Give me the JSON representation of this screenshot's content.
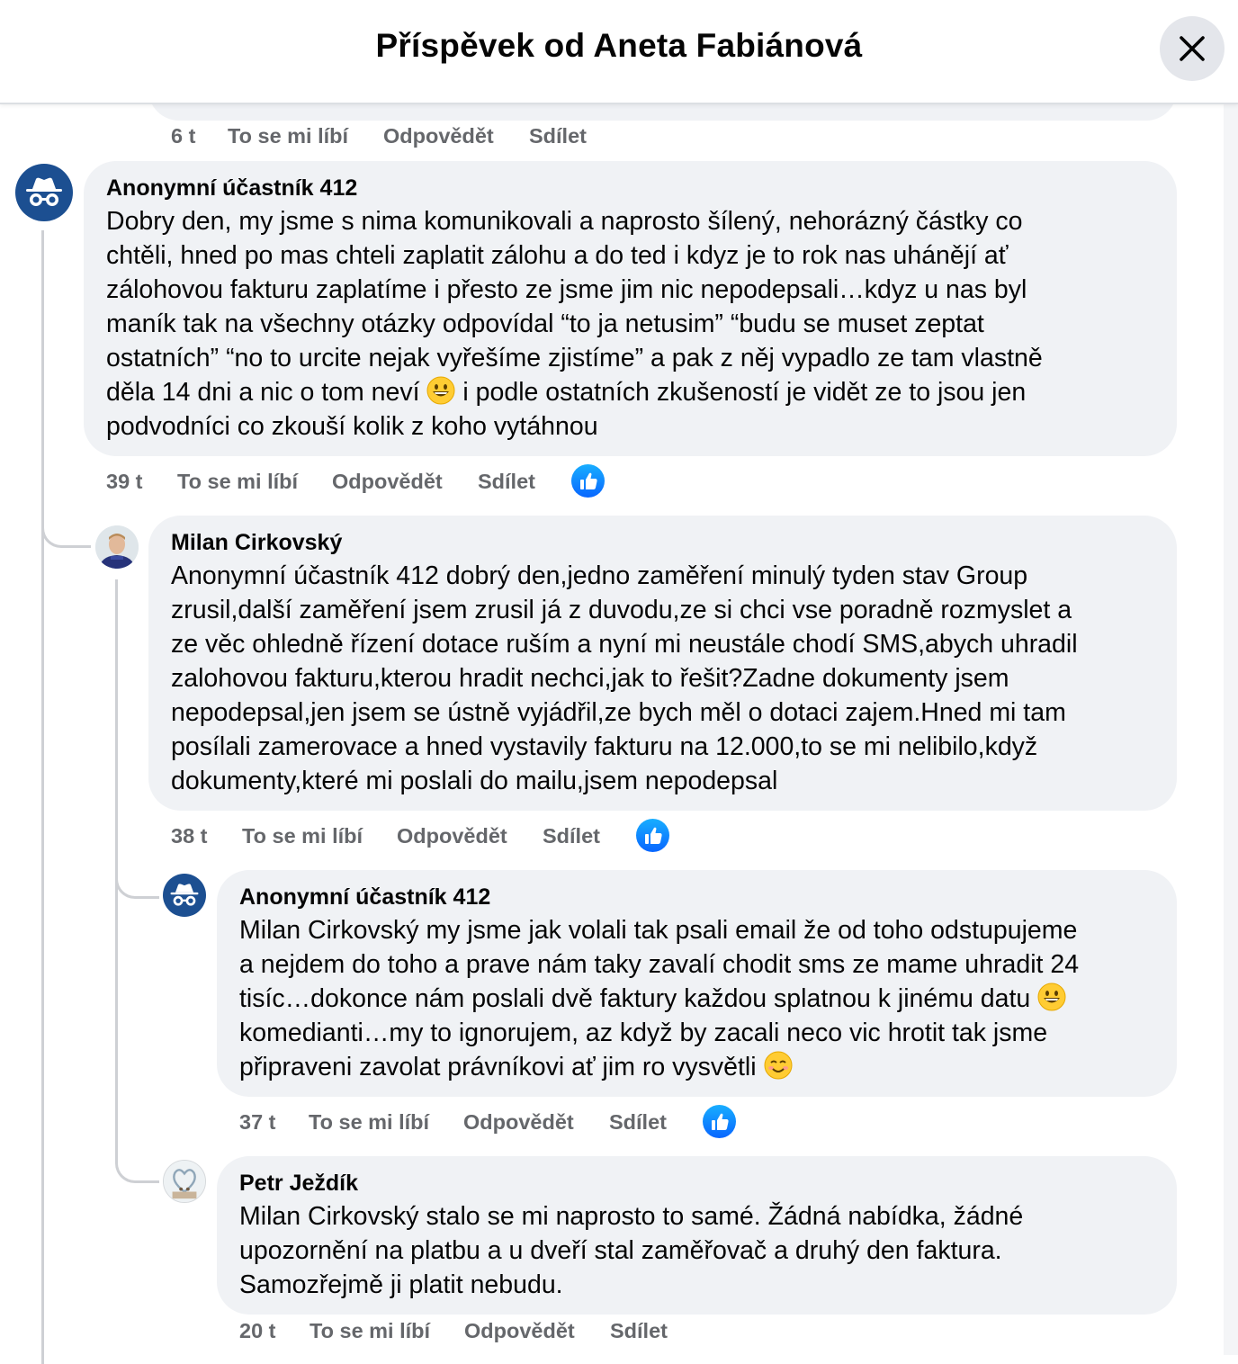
{
  "header": {
    "title": "Příspěvek od Aneta Fabiánová"
  },
  "meta_labels": {
    "like": "To se mi líbí",
    "reply": "Odpovědět",
    "share": "Sdílet"
  },
  "top_meta": {
    "time": "6 t"
  },
  "comments": [
    {
      "author": "Anonymní účastník 412",
      "avatar": "incognito-avatar",
      "lines": [
        "Dobry den, my jsme s nima komunikovali a naprosto šílený, nehorázný částky co",
        "chtěli, hned po mas chteli zaplatit zálohu a do ted i kdyz je to rok nas uhánějí ať",
        "zálohovou fakturu zaplatíme i přesto ze jsme jim nic nepodepsali…kdyz u nas byl",
        "maník tak na všechny otázky odpovídal “to ja netusim” “budu se muset zeptat",
        "ostatních” “no to urcite nejak vyřešíme zjistíme” a pak z něj vypadlo ze tam vlastně",
        "děla 14 dni a nic o tom neví",
        " i podle ostatních zkušeností je vidět ze to jsou jen",
        "podvodníci co zkouší kolik z koho vytáhnou"
      ],
      "time": "39 t",
      "liked": true
    },
    {
      "author": "Milan Cirkovský",
      "avatar": "user-photo-avatar",
      "lines": [
        "Anonymní účastník 412 dobrý den,jedno zaměření minulý tyden stav Group",
        "zrusil,další zaměření jsem zrusil já z duvodu,ze si chci vse poradně rozmyslet a",
        "ze věc ohledně řízení dotace ruším a nyní mi neustále chodí SMS,abych uhradil",
        "zalohovou fakturu,kterou hradit nechci,jak to řešit?Zadne dokumenty jsem",
        "nepodepsal,jen jsem se ústně vyjádřil,ze bych měl o dotaci zajem.Hned mi tam",
        "posílali zamerovace a hned vystavily fakturu na 12.000,to se mi nelibilo,když",
        "dokumenty,které mi poslali do mailu,jsem nepodepsal"
      ],
      "time": "38 t",
      "liked": true
    },
    {
      "author": "Anonymní účastník 412",
      "avatar": "incognito-avatar",
      "lines": [
        "Milan Cirkovský my jsme jak volali tak psali email že od toho odstupujeme",
        "a nejdem do toho a prave nám taky zavalí chodit sms ze mame uhradit 24",
        "tisíc…dokonce nám poslali dvě faktury každou splatnou k jinému datu",
        "komedianti…my to ignorujem, az když by zacali neco vic hrotit tak jsme",
        "připraveni zavolat právníkovi ať jim ro vysvětli"
      ],
      "time": "37 t",
      "liked": true
    },
    {
      "author": "Petr Ježdík",
      "avatar": "user-photo-avatar",
      "lines": [
        "Milan Cirkovský stalo se mi naprosto to samé. Žádná nabídka, žádné",
        "upozornění na platbu a u dveří stal zaměřovač a druhý den faktura.",
        "Samozřejmě ji platit nebudu."
      ],
      "time": "20 t",
      "liked": false
    }
  ],
  "colors": {
    "bubble": "#f0f2f5",
    "meta_text": "#65676b",
    "like_blue": "#0866ff",
    "anon_avatar": "#1c4f91",
    "thread_line": "#ced0d4"
  }
}
